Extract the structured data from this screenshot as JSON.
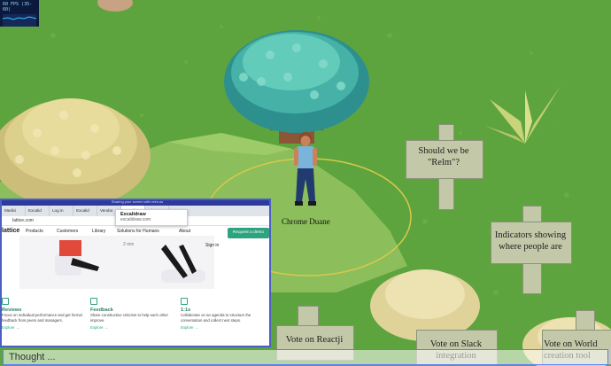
{
  "hud": {
    "fps": "60 FPS (35-60)"
  },
  "player": {
    "name": "Chrome Duane"
  },
  "signs": [
    {
      "text": "Should we be \"Relm\"?"
    },
    {
      "text": "Indicators showing where people are"
    },
    {
      "text": "Vote on Reactji"
    },
    {
      "text": "Vote on Slack integration"
    },
    {
      "text": "Vote on World creation tool"
    }
  ],
  "screenshare": {
    "banner": "Sharing your screen with relm.us",
    "tabs": [
      "Medici",
      "Excalid",
      "Log in",
      "Excalid",
      "Vendor",
      "People",
      "Inkamu"
    ],
    "url": "lattice.com",
    "tooltip": {
      "title": "Excalidraw",
      "subtitle": "excalidraw.com"
    },
    "brand": "lattice",
    "nav": [
      "Products",
      "Customers",
      "Library",
      "Solutions for Humans",
      "About"
    ],
    "sign_in": "Sign in",
    "cta": "Request a demo",
    "read_time": "2 min",
    "features": [
      {
        "title": "Reviews",
        "desc": "Focus on individual performance and get formal feedback from peers and managers.",
        "link": "Explore →"
      },
      {
        "title": "Feedback",
        "desc": "Share constructive criticism to help each other improve.",
        "link": "Explore →"
      },
      {
        "title": "1:1s",
        "desc": "Collaborate on an agenda to structure the conversation and collect next steps.",
        "link": "Explore →"
      }
    ]
  },
  "thought_input": {
    "placeholder": "Thought ..."
  }
}
